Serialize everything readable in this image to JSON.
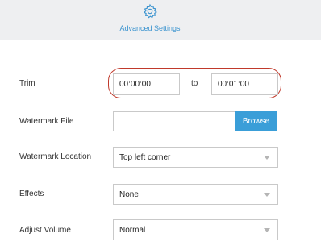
{
  "header": {
    "icon": "gear-icon",
    "title": "Advanced Settings",
    "accent_color": "#3a93cf"
  },
  "trim": {
    "label": "Trim",
    "start_value": "00:00:00",
    "separator": "to",
    "end_value": "00:01:00",
    "highlight_color": "#c0392b"
  },
  "watermark_file": {
    "label": "Watermark File",
    "value": "",
    "browse_label": "Browse",
    "browse_color": "#3a9ed8"
  },
  "watermark_location": {
    "label": "Watermark Location",
    "selected": "Top left corner"
  },
  "effects": {
    "label": "Effects",
    "selected": "None"
  },
  "adjust_volume": {
    "label": "Adjust Volume",
    "selected": "Normal"
  }
}
